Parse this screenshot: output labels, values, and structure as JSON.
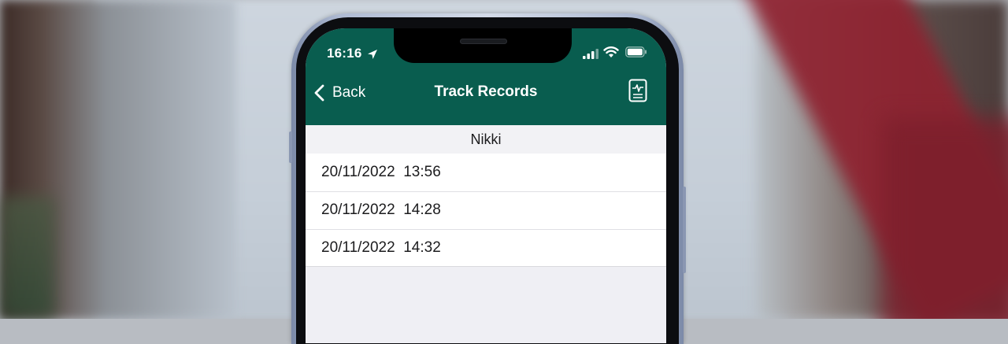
{
  "status_bar": {
    "time": "16:16",
    "icons": [
      "location-arrow-icon",
      "cellular-signal-icon",
      "wifi-icon",
      "battery-icon"
    ]
  },
  "nav_bar": {
    "back_label": "Back",
    "title": "Track Records",
    "right_icon": "document-chart-icon",
    "background_color": "#095d4f"
  },
  "section": {
    "header": "Nikki"
  },
  "records": [
    {
      "label": "20/11/2022  13:56"
    },
    {
      "label": "20/11/2022  14:28"
    },
    {
      "label": "20/11/2022  14:32"
    }
  ],
  "colors": {
    "accent": "#095d4f",
    "list_background": "#efeff4"
  }
}
